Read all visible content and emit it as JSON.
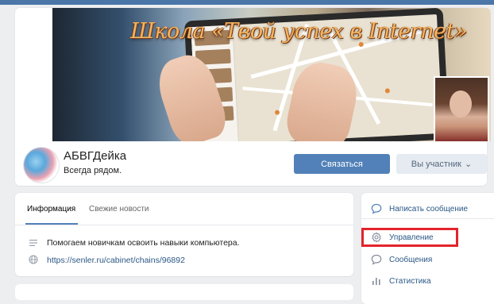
{
  "cover": {
    "title": "Школа «Твой успех в Internet»"
  },
  "group": {
    "name": "АБВГДейка",
    "status": "Всегда рядом."
  },
  "actions": {
    "contact_label": "Связаться",
    "member_label": "Вы участник",
    "member_chevron": "⌄"
  },
  "info": {
    "tabs": [
      {
        "label": "Информация",
        "active": true
      },
      {
        "label": "Свежие новости",
        "active": false
      }
    ],
    "description": "Помогаем новичкам освоить навыки компьютера.",
    "link": "https://senler.ru/cabinet/chains/96892"
  },
  "sidebar": {
    "items": [
      {
        "label": "Написать сообщение",
        "icon": "chat-bubble-icon"
      },
      {
        "label": "Управление",
        "icon": "gear-icon"
      },
      {
        "label": "Сообщения",
        "icon": "chat-bubble-icon"
      },
      {
        "label": "Статистика",
        "icon": "bar-chart-icon"
      }
    ]
  },
  "colors": {
    "accent": "#5181b8",
    "link": "#2a5885",
    "highlight": "#e3242b",
    "page_bg": "#edeef0"
  }
}
